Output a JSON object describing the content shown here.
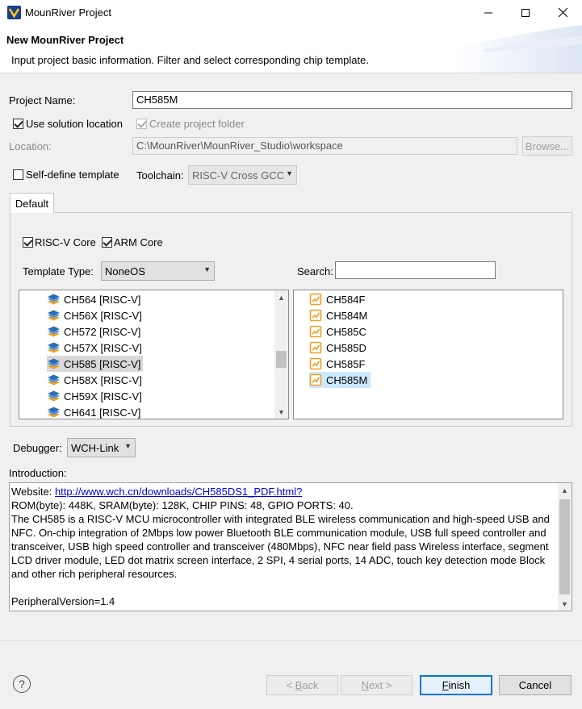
{
  "window": {
    "title": "MounRiver Project",
    "minimize_icon": "minimize-icon",
    "maximize_icon": "maximize-icon",
    "close_icon": "close-icon"
  },
  "banner": {
    "title": "New MounRiver Project",
    "description": "Input project basic information. Filter and select corresponding chip template."
  },
  "form": {
    "project_name_label": "Project Name:",
    "project_name_value": "CH585M",
    "use_solution_location_label": "Use solution location",
    "use_solution_location_checked": true,
    "create_project_folder_label": "Create project folder",
    "create_project_folder_checked": true,
    "location_label": "Location:",
    "location_value": "C:\\MounRiver\\MounRiver_Studio\\workspace",
    "browse_label": "Browse...",
    "self_define_template_label": "Self-define template",
    "self_define_template_checked": false,
    "toolchain_label": "Toolchain:",
    "toolchain_value": "RISC-V Cross GCC"
  },
  "tabs": [
    {
      "label": "Default",
      "active": true
    }
  ],
  "filters": {
    "riscv_core_label": "RISC-V Core",
    "riscv_core_checked": true,
    "arm_core_label": "ARM Core",
    "arm_core_checked": true,
    "template_type_label": "Template Type:",
    "template_type_value": "NoneOS",
    "search_label": "Search:",
    "search_value": ""
  },
  "chip_families": [
    {
      "label": "CH564 [RISC-V]",
      "selected": false
    },
    {
      "label": "CH56X [RISC-V]",
      "selected": false
    },
    {
      "label": "CH572 [RISC-V]",
      "selected": false
    },
    {
      "label": "CH57X [RISC-V]",
      "selected": false
    },
    {
      "label": "CH585 [RISC-V]",
      "selected": true
    },
    {
      "label": "CH58X [RISC-V]",
      "selected": false
    },
    {
      "label": "CH59X [RISC-V]",
      "selected": false
    },
    {
      "label": "CH641 [RISC-V]",
      "selected": false
    }
  ],
  "chip_models": [
    {
      "label": "CH584F",
      "selected": false
    },
    {
      "label": "CH584M",
      "selected": false
    },
    {
      "label": "CH585C",
      "selected": false
    },
    {
      "label": "CH585D",
      "selected": false
    },
    {
      "label": "CH585F",
      "selected": false
    },
    {
      "label": "CH585M",
      "selected": true
    }
  ],
  "debugger": {
    "label": "Debugger:",
    "value": "WCH-Link"
  },
  "introduction": {
    "label": "Introduction:",
    "website_label": "Website: ",
    "website_url": "http://www.wch.cn/downloads/CH585DS1_PDF.html?",
    "rom_line": "ROM(byte): 448K, SRAM(byte): 128K, CHIP PINS: 48, GPIO PORTS: 40.",
    "description": "The CH585 is a RISC-V MCU microcontroller with integrated BLE wireless communication and high-speed USB and NFC. On-chip integration of 2Mbps low power Bluetooth BLE communication module, USB full speed controller and transceiver, USB high speed controller and transceiver (480Mbps), NFC near field pass Wireless interface, segment LCD driver module, LED dot matrix screen interface, 2 SPI, 4 serial ports, 14 ADC, touch key detection mode Block and other rich peripheral resources.",
    "peripheral_version": "PeripheralVersion=1.4"
  },
  "buttons": {
    "back_prefix": "< ",
    "back_mnemonic": "B",
    "back_rest": "ack",
    "next_mnemonic": "N",
    "next_rest": "ext >",
    "finish_mnemonic": "F",
    "finish_rest": "inish",
    "cancel": "Cancel",
    "help_icon": "help-icon"
  },
  "colors": {
    "accent": "#0078d7",
    "selection": "#cce8ff",
    "link": "#0000ee",
    "chip_icon_orange": "#f0a020"
  }
}
